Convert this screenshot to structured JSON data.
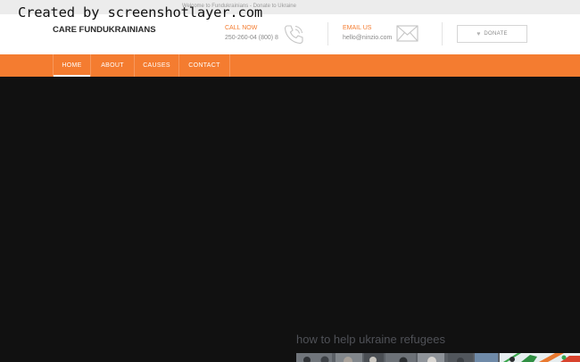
{
  "watermark": "Created by screenshotlayer.com",
  "topbar": {
    "text": "Welcome to Fundukrainians - Donate to Ukraine"
  },
  "brand": {
    "name": "CARE FUNDUKRAINIANS"
  },
  "contact": {
    "call_label": "CALL NOW",
    "call_value": "250-260-04 (800) 8",
    "email_label": "EMAIL US",
    "email_value": "hello@ninzio.com"
  },
  "donate": {
    "label": "DONATE",
    "icon": "heart-icon"
  },
  "nav": {
    "items": [
      {
        "label": "HOME",
        "active": true
      },
      {
        "label": "ABOUT",
        "active": false
      },
      {
        "label": "CAUSES",
        "active": false
      },
      {
        "label": "CONTACT",
        "active": false
      }
    ]
  },
  "promo": {
    "title": "how to help ukraine refugees"
  },
  "colors": {
    "accent": "#f47c30",
    "hero_bg": "#111111",
    "header_bg": "#ffffff",
    "topbar_bg": "#ececec"
  }
}
